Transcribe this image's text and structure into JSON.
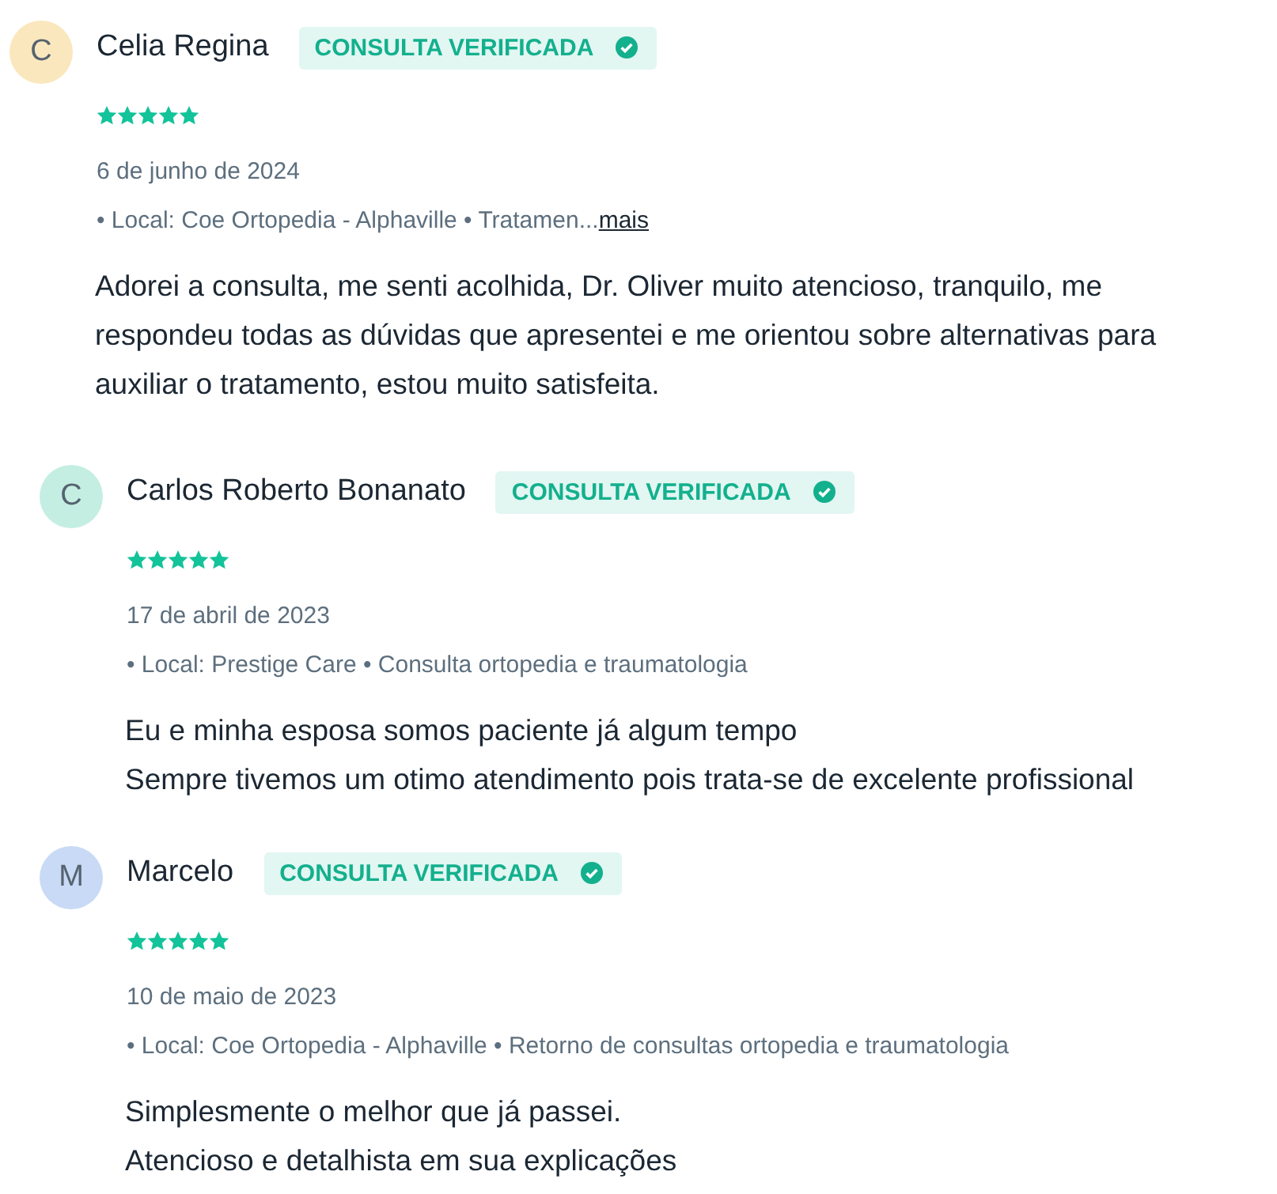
{
  "reviews": [
    {
      "initial": "C",
      "color": "#fbe7bd",
      "name": "Celia Regina",
      "badge": "CONSULTA VERIFICADA",
      "stars": 5,
      "date": "6 de junho de 2024",
      "details": "• Local: Coe Ortopedia - Alphaville • Tratamen...",
      "more": "mais",
      "comment": "Adorei a consulta, me senti acolhida, Dr. Oliver muito atencioso, tranquilo, me respondeu todas as dúvidas que apresentei e me orientou sobre alternativas para auxiliar o tratamento, estou muito satisfeita."
    },
    {
      "initial": "C",
      "color": "#c4eee2",
      "name": "Carlos Roberto Bonanato",
      "badge": "CONSULTA VERIFICADA",
      "stars": 5,
      "date": "17 de abril de 2023",
      "details": "• Local: Prestige Care • Consulta ortopedia e traumatologia",
      "comment": "Eu e minha esposa somos paciente já algum tempo\nSempre tivemos um otimo atendimento pois trata-se de excelente profissional"
    },
    {
      "initial": "M",
      "color": "#c8daf5",
      "name": "Marcelo",
      "badge": "CONSULTA VERIFICADA",
      "stars": 5,
      "date": "10 de maio de 2023",
      "details": "• Local: Coe Ortopedia - Alphaville • Retorno de consultas ortopedia e traumatologia",
      "comment": "Simplesmente o melhor que já passei.\nAtencioso e detalhista em sua explicações"
    }
  ]
}
